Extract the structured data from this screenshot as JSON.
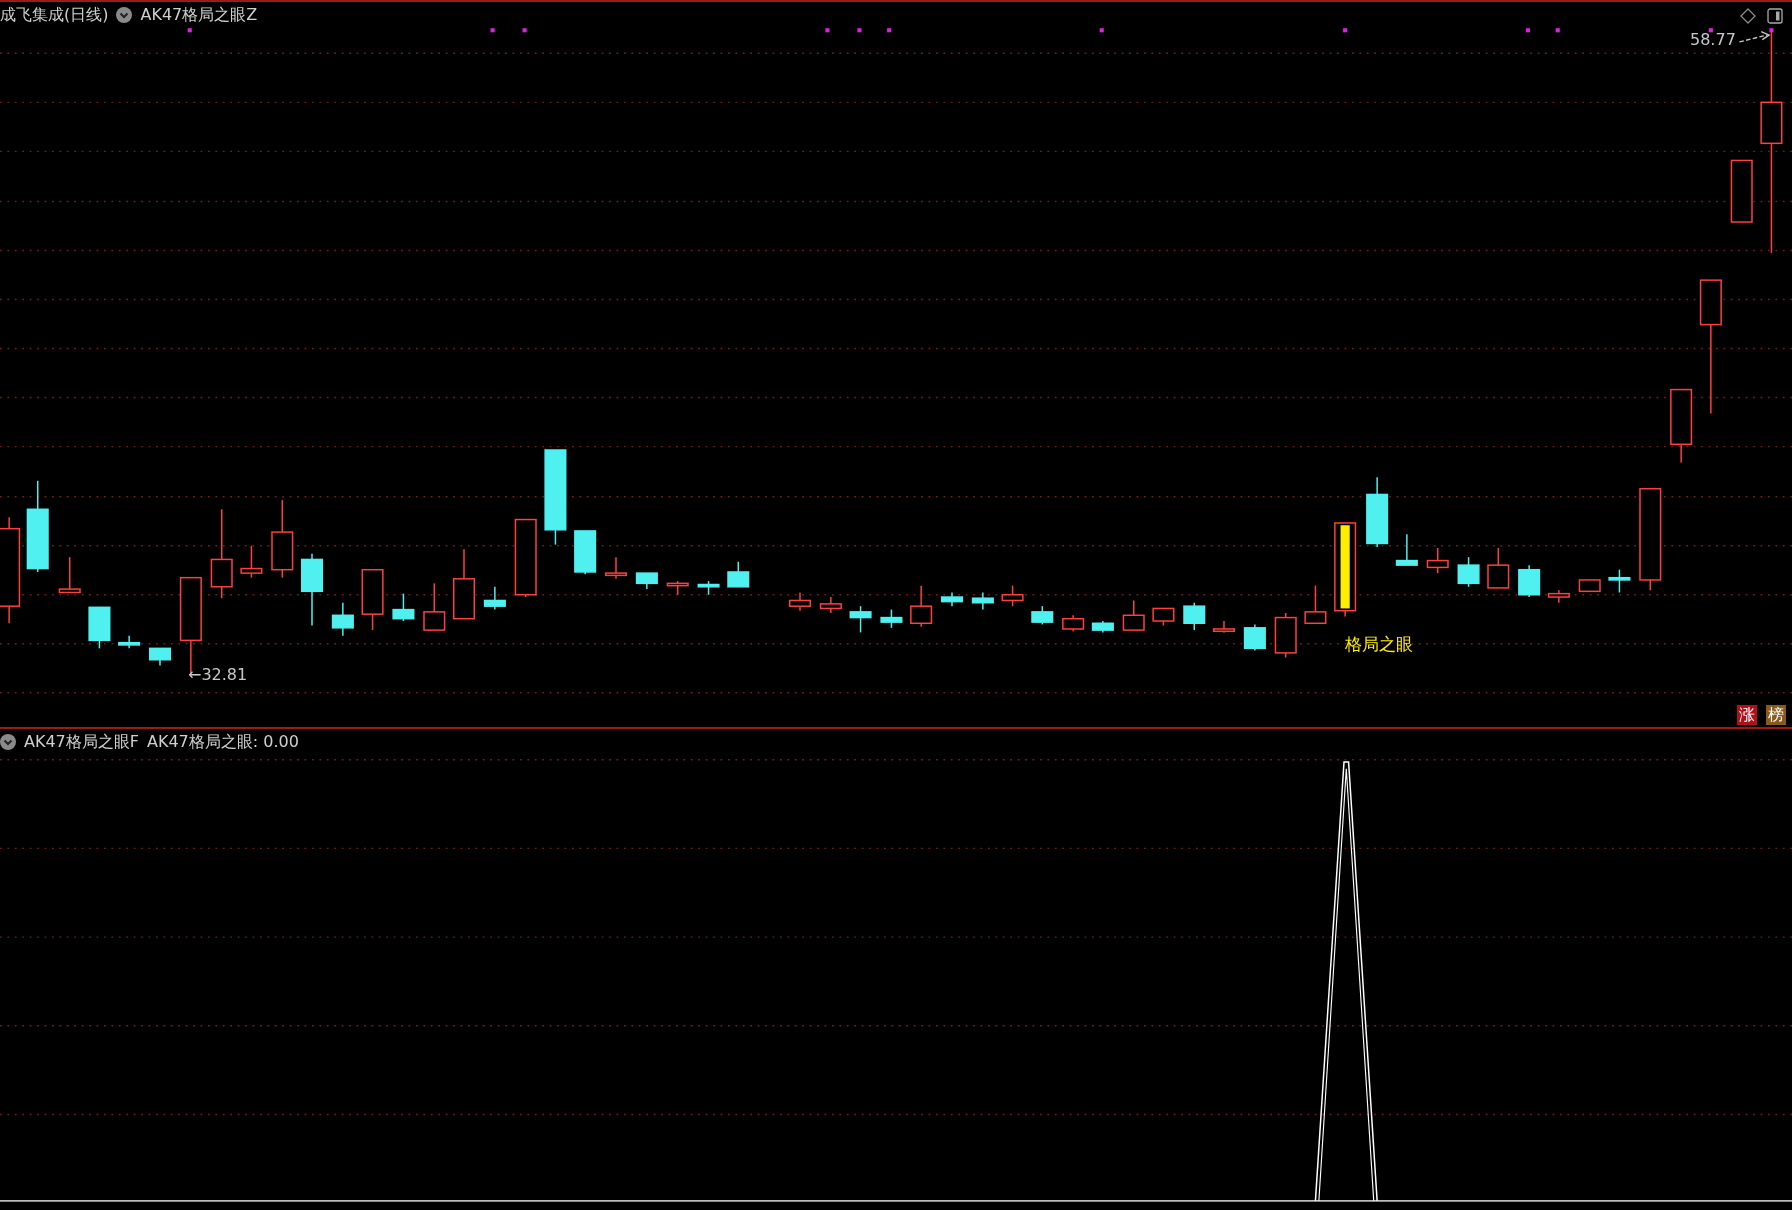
{
  "main_panel": {
    "stock_title": "成飞集成(日线)",
    "indicator_name": "AK47格局之眼Z",
    "low_label": "←32.81",
    "high_label": "58.77",
    "signal_label": "格局之眼",
    "badges": [
      {
        "text": "涨",
        "color": "#b0101a"
      },
      {
        "text": "榜",
        "color": "#8a5a1a"
      }
    ]
  },
  "sub_panel": {
    "indicator_name": "AK47格局之眼F",
    "reading": "AK47格局之眼: 0.00"
  }
}
